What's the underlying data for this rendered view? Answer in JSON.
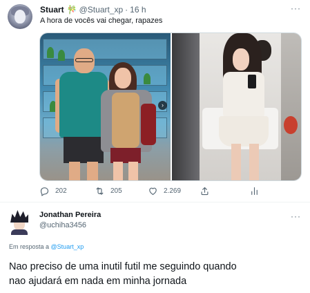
{
  "tweet": {
    "author_name": "Stuart",
    "author_emoji": "🎋",
    "handle": "@Stuart_xp",
    "separator": "·",
    "time": "16 h",
    "more": "···",
    "text": "A hora de vocês vai chegar, rapazes",
    "media_nav_arrow": "›",
    "actions": {
      "replies": "202",
      "retweets": "205",
      "likes": "2.269"
    }
  },
  "reply": {
    "author_name": "Jonathan Pereira",
    "handle": "@uchiha3456",
    "more": "···",
    "in_reply_prefix": "Em resposta a",
    "in_reply_mention": "@Stuart_xp",
    "text_lines": [
      "Nao preciso de uma inutil futil me seguindo quando",
      "nao ajudará em nada em minha jornada"
    ]
  },
  "colors": {
    "text_primary": "#0f1419",
    "text_secondary": "#536471",
    "link": "#1d9bf0",
    "divider": "#eff3f4"
  },
  "icons": [
    "reply-icon",
    "retweet-icon",
    "like-icon",
    "share-icon",
    "more-icon",
    "chevron-right-icon"
  ]
}
